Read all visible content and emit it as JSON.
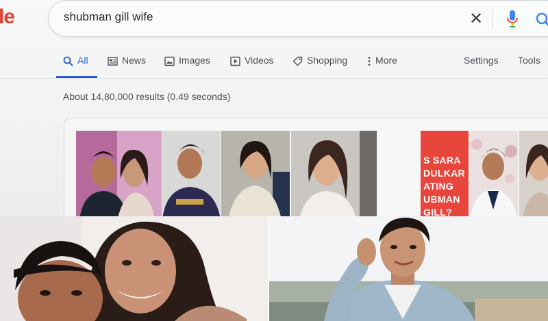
{
  "browser": {
    "logo_fragment": "le",
    "search": {
      "query": "shubman gill wife",
      "clear_icon": "close-icon",
      "mic_icon": "microphone-icon",
      "search_icon": "search-icon"
    },
    "tabs": [
      {
        "label": "All",
        "icon": "search-icon",
        "active": true
      },
      {
        "label": "News",
        "icon": "news-icon",
        "active": false
      },
      {
        "label": "Images",
        "icon": "image-icon",
        "active": false
      },
      {
        "label": "Videos",
        "icon": "video-icon",
        "active": false
      },
      {
        "label": "Shopping",
        "icon": "tag-icon",
        "active": false
      },
      {
        "label": "More",
        "icon": "more-vert-icon",
        "active": false
      }
    ],
    "settings_label": "Settings",
    "tools_label": "Tools",
    "result_stats": "About 14,80,000 results (0.49 seconds)",
    "image_results": {
      "thumbnail_caption": "S SARA\nDULKAR\nATING\nUBMAN\nGILL?"
    }
  },
  "colors": {
    "accent_blue": "#2b5bd7",
    "logo_red": "#e3402f",
    "caption_panel": "#e8453c"
  }
}
